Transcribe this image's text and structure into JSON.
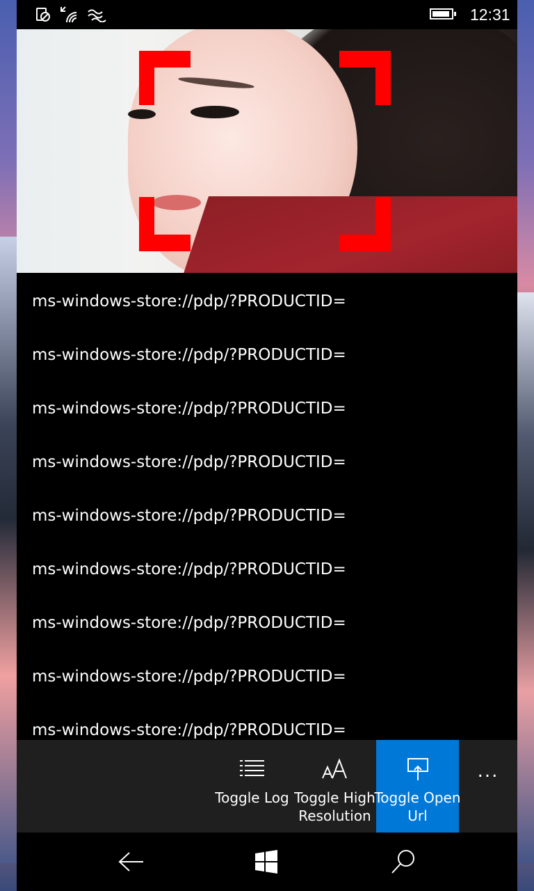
{
  "status_bar": {
    "time": "12:31",
    "icons": [
      "data-saver-icon",
      "wifi-icon",
      "vpn-icon",
      "battery-icon"
    ]
  },
  "camera_preview": {
    "overlay_color": "#ff0000"
  },
  "log": {
    "lines": [
      "ms-windows-store://pdp/?PRODUCTID=",
      "ms-windows-store://pdp/?PRODUCTID=",
      "ms-windows-store://pdp/?PRODUCTID=",
      "ms-windows-store://pdp/?PRODUCTID=",
      "ms-windows-store://pdp/?PRODUCTID=",
      "ms-windows-store://pdp/?PRODUCTID=",
      "ms-windows-store://pdp/?PRODUCTID=",
      "ms-windows-store://pdp/?PRODUCTID=",
      "ms-windows-store://pdp/?PRODUCTID="
    ]
  },
  "app_bar": {
    "buttons": [
      {
        "label": "Toggle Log",
        "icon": "list-icon",
        "active": false
      },
      {
        "label": "Toggle High Resolution",
        "icon": "font-size-icon",
        "active": false
      },
      {
        "label": "Toggle Open Url",
        "icon": "open-url-icon",
        "active": true
      }
    ],
    "more_label": "...",
    "accent_color": "#0078d7"
  },
  "nav_bar": {
    "buttons": [
      "back-arrow-icon",
      "windows-start-icon",
      "search-icon"
    ]
  }
}
